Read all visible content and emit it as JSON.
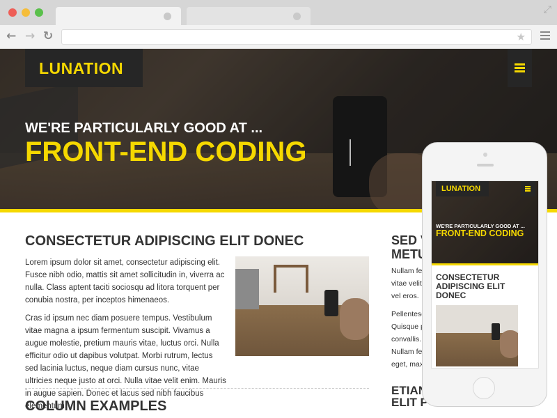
{
  "browser": {
    "traffic_lights": [
      "#ee5e57",
      "#f5bd3a",
      "#5ac04b"
    ],
    "back_icon": "arrow-left",
    "forward_icon": "arrow-right",
    "reload_icon": "reload",
    "bookmark_icon": "star",
    "menu_icon": "hamburger",
    "url": ""
  },
  "site": {
    "brand": "LUNATION",
    "accent_color": "#f5d800",
    "hero": {
      "line1": "WE'RE PARTICULARLY GOOD AT ...",
      "line2": "FRONT-END CODING"
    },
    "section1": {
      "heading": "CONSECTETUR ADIPISCING ELIT DONEC",
      "para1": "Lorem ipsum dolor sit amet, consectetur adipiscing elit. Fusce nibh odio, mattis sit amet sollicitudin in, viverra ac nulla. Class aptent taciti sociosqu ad litora torquent per conubia nostra, per inceptos himenaeos.",
      "para2": "Cras id ipsum nec diam posuere tempus. Vestibulum vitae magna a ipsum fermentum suscipit. Vivamus a augue molestie, pretium mauris vitae, luctus orci. Nulla efficitur odio ut dapibus volutpat. Morbi rutrum, lectus sed lacinia luctus, neque diam cursus nunc, vitae ultricies neque justo at orci. Nulla vitae velit enim. Mauris in augue sapien. Donec et lacus sed nibh faucibus elementum."
    },
    "section2": {
      "heading": "COLUMN EXAMPLES"
    },
    "sidebar": {
      "heading": "SED V\nMETU",
      "para1": "Nullam fer\nvitae velit\nvel eros.",
      "para2": "Pellentesq\nQuisque p\nconvallis. S\nNullam fer\neget, maxi",
      "heading2": "ETIAN\nELIT P"
    }
  },
  "mobile": {
    "brand": "LUNATION",
    "hero_line1": "WE'RE PARTICULARLY GOOD AT ...",
    "hero_line2": "FRONT-END CODING",
    "heading": "CONSECTETUR ADIPISCING ELIT DONEC"
  }
}
